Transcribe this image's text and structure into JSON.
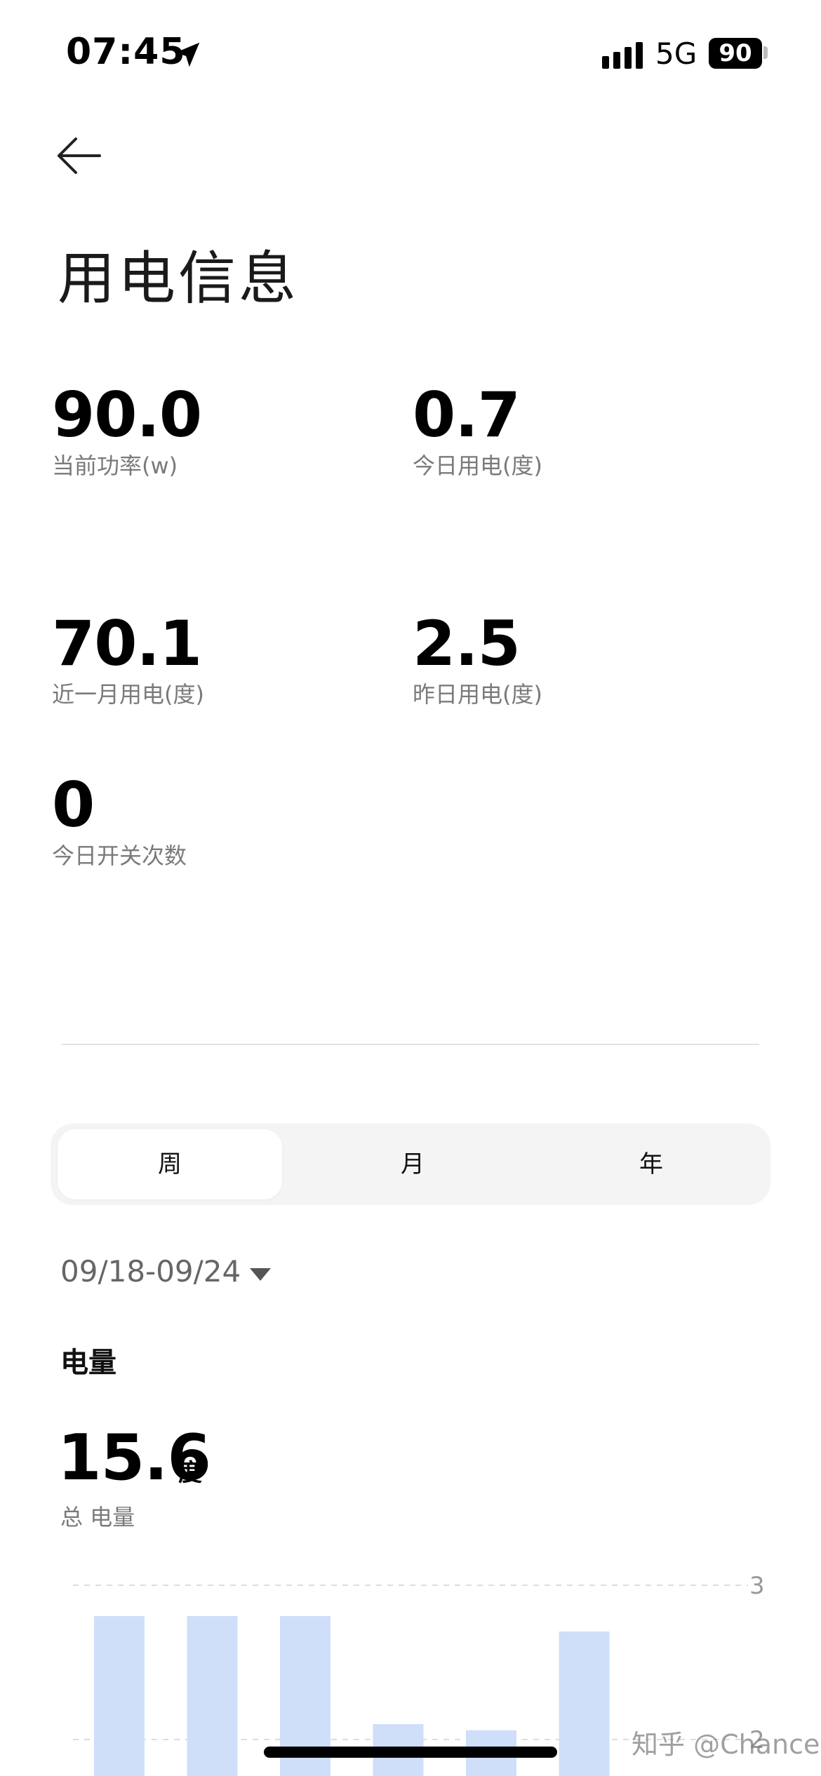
{
  "status_bar": {
    "time": "07:45",
    "network": "5G",
    "battery": "90"
  },
  "header": {
    "title": "用电信息"
  },
  "stats": [
    {
      "value": "90.0",
      "label": "当前功率(w)"
    },
    {
      "value": "0.7",
      "label": "今日用电(度)"
    },
    {
      "value": "70.1",
      "label": "近一月用电(度)"
    },
    {
      "value": "2.5",
      "label": "昨日用电(度)"
    },
    {
      "value": "0",
      "label": "今日开关次数"
    }
  ],
  "period_tabs": {
    "items": [
      "周",
      "月",
      "年"
    ],
    "selected": "周"
  },
  "date_range": "09/18-09/24",
  "energy": {
    "section_title": "电量",
    "total_value": "15.6",
    "total_unit": "度",
    "total_label": "总 电量"
  },
  "chart_data": {
    "type": "bar",
    "y_ticks": [
      3,
      2
    ],
    "values": [
      2.8,
      2.8,
      2.8,
      2.1,
      2.06,
      2.7
    ],
    "ylim_visible": [
      2,
      3
    ],
    "grid": "dashed",
    "bar_color": "#cfdffa"
  },
  "watermark": "知乎 @Chance",
  "colors": {
    "bar": "#cfdffa",
    "label": "#7a7a7a",
    "segment_bg": "#f4f4f4"
  }
}
